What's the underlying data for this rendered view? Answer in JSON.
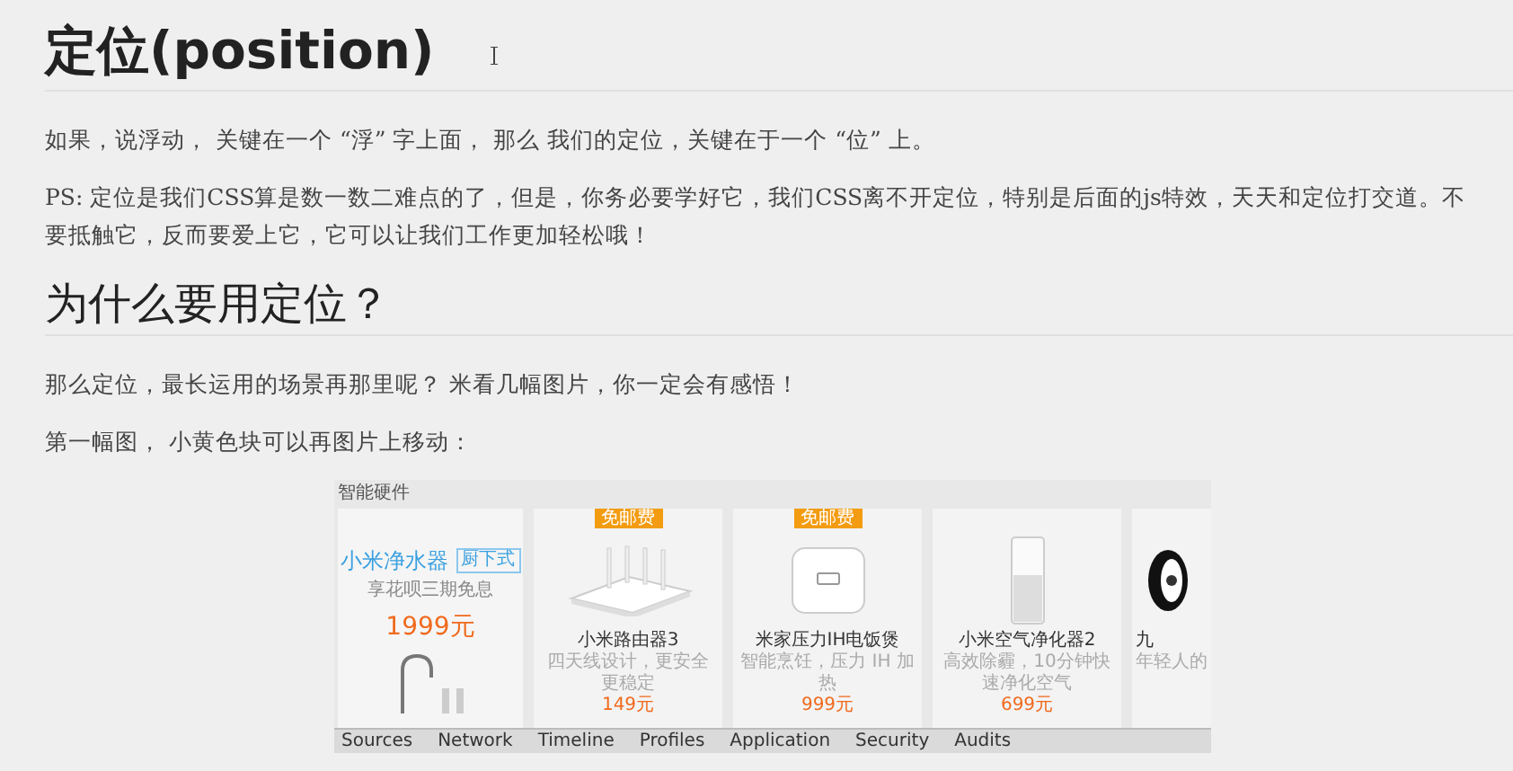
{
  "blocks": [
    {
      "kind": "h1",
      "text": "定位(position)"
    },
    {
      "kind": "p",
      "text": "如果，说浮动， 关键在一个 “浮” 字上面，  那么 我们的定位，关键在于一个 “位” 上。"
    },
    {
      "kind": "p",
      "text": "PS: 定位是我们CSS算是数一数二难点的了，但是，你务必要学好它，我们CSS离不开定位，特别是后面的js特效，天天和定位打交道。不要抵触它，反而要爱上它，它可以让我们工作更加轻松哦！"
    },
    {
      "kind": "h2",
      "text": "为什么要用定位？"
    },
    {
      "kind": "p",
      "text": "那么定位，最长运用的场景再那里呢？   米看几幅图片，你一定会有感悟！"
    },
    {
      "kind": "p",
      "text": "第一幅图，  小黄色块可以再图片上移动："
    },
    {
      "kind": "shot",
      "section_title": "智能硬件",
      "promo": {
        "name": "小米净水器",
        "tag": "厨下式",
        "subtitle": "享花呗三期免息",
        "price": "1999元"
      },
      "products": [
        {
          "kind": "router",
          "badge": "免邮费",
          "name": "小米路由器3",
          "subtitle": "四天线设计，更安全更稳定",
          "price": "149元"
        },
        {
          "kind": "cooker",
          "badge": "免邮费",
          "name": "米家压力IH电饭煲",
          "subtitle": "智能烹饪，压力 IH 加热",
          "price": "999元"
        },
        {
          "kind": "purifier",
          "name": "小米空气净化器2",
          "subtitle": "高效除霾，10分钟快速净化空气",
          "price": "699元"
        },
        {
          "kind": "wheel",
          "name": "九",
          "subtitle": "年轻人的"
        }
      ],
      "devtools_tabs": [
        "Sources",
        "Network",
        "Timeline",
        "Profiles",
        "Application",
        "Security",
        "Audits"
      ]
    }
  ]
}
